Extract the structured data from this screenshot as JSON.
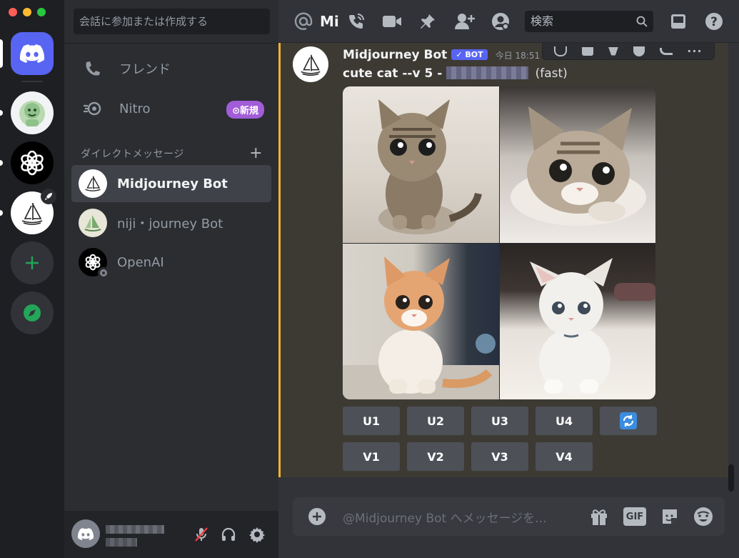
{
  "window": {
    "controls": [
      "#ff5f57",
      "#febc2e",
      "#28c840"
    ]
  },
  "servers": [
    {
      "name": "discord-home",
      "color": "#5865f2"
    },
    {
      "name": "server-green-bot",
      "color": "#f2f3f5"
    },
    {
      "name": "server-openai",
      "color": "#000000"
    },
    {
      "name": "server-midjourney",
      "color": "#ffffff"
    }
  ],
  "sidebar": {
    "search_placeholder": "会話に参加または作成する",
    "friends_label": "フレンド",
    "nitro_label": "Nitro",
    "nitro_badge": "新規",
    "dm_header": "ダイレクトメッセージ",
    "dm_add": "+",
    "dms": [
      {
        "name": "Midjourney Bot",
        "active": true
      },
      {
        "name": "niji・journey Bot",
        "active": false
      },
      {
        "name": "OpenAI",
        "active": false
      }
    ]
  },
  "topbar": {
    "channel_fragment": "Mi",
    "search_placeholder": "検索"
  },
  "message": {
    "author": "Midjourney Bot",
    "bot_tag": "BOT",
    "timestamp": "今日 18:51",
    "prompt_bold": "cute cat --v 5 - ",
    "prompt_suffix": "(fast)"
  },
  "buttons": {
    "upscale": [
      "U1",
      "U2",
      "U3",
      "U4"
    ],
    "variation": [
      "V1",
      "V2",
      "V3",
      "V4"
    ],
    "reroll_icon": "refresh-icon"
  },
  "composer": {
    "placeholder": "@Midjourney Bot へメッセージを...",
    "gif_label": "GIF"
  },
  "colors": {
    "accent": "#5865f2",
    "highlight": "#f0b232",
    "nitro": "#a15cd8",
    "online": "#23a55a"
  }
}
